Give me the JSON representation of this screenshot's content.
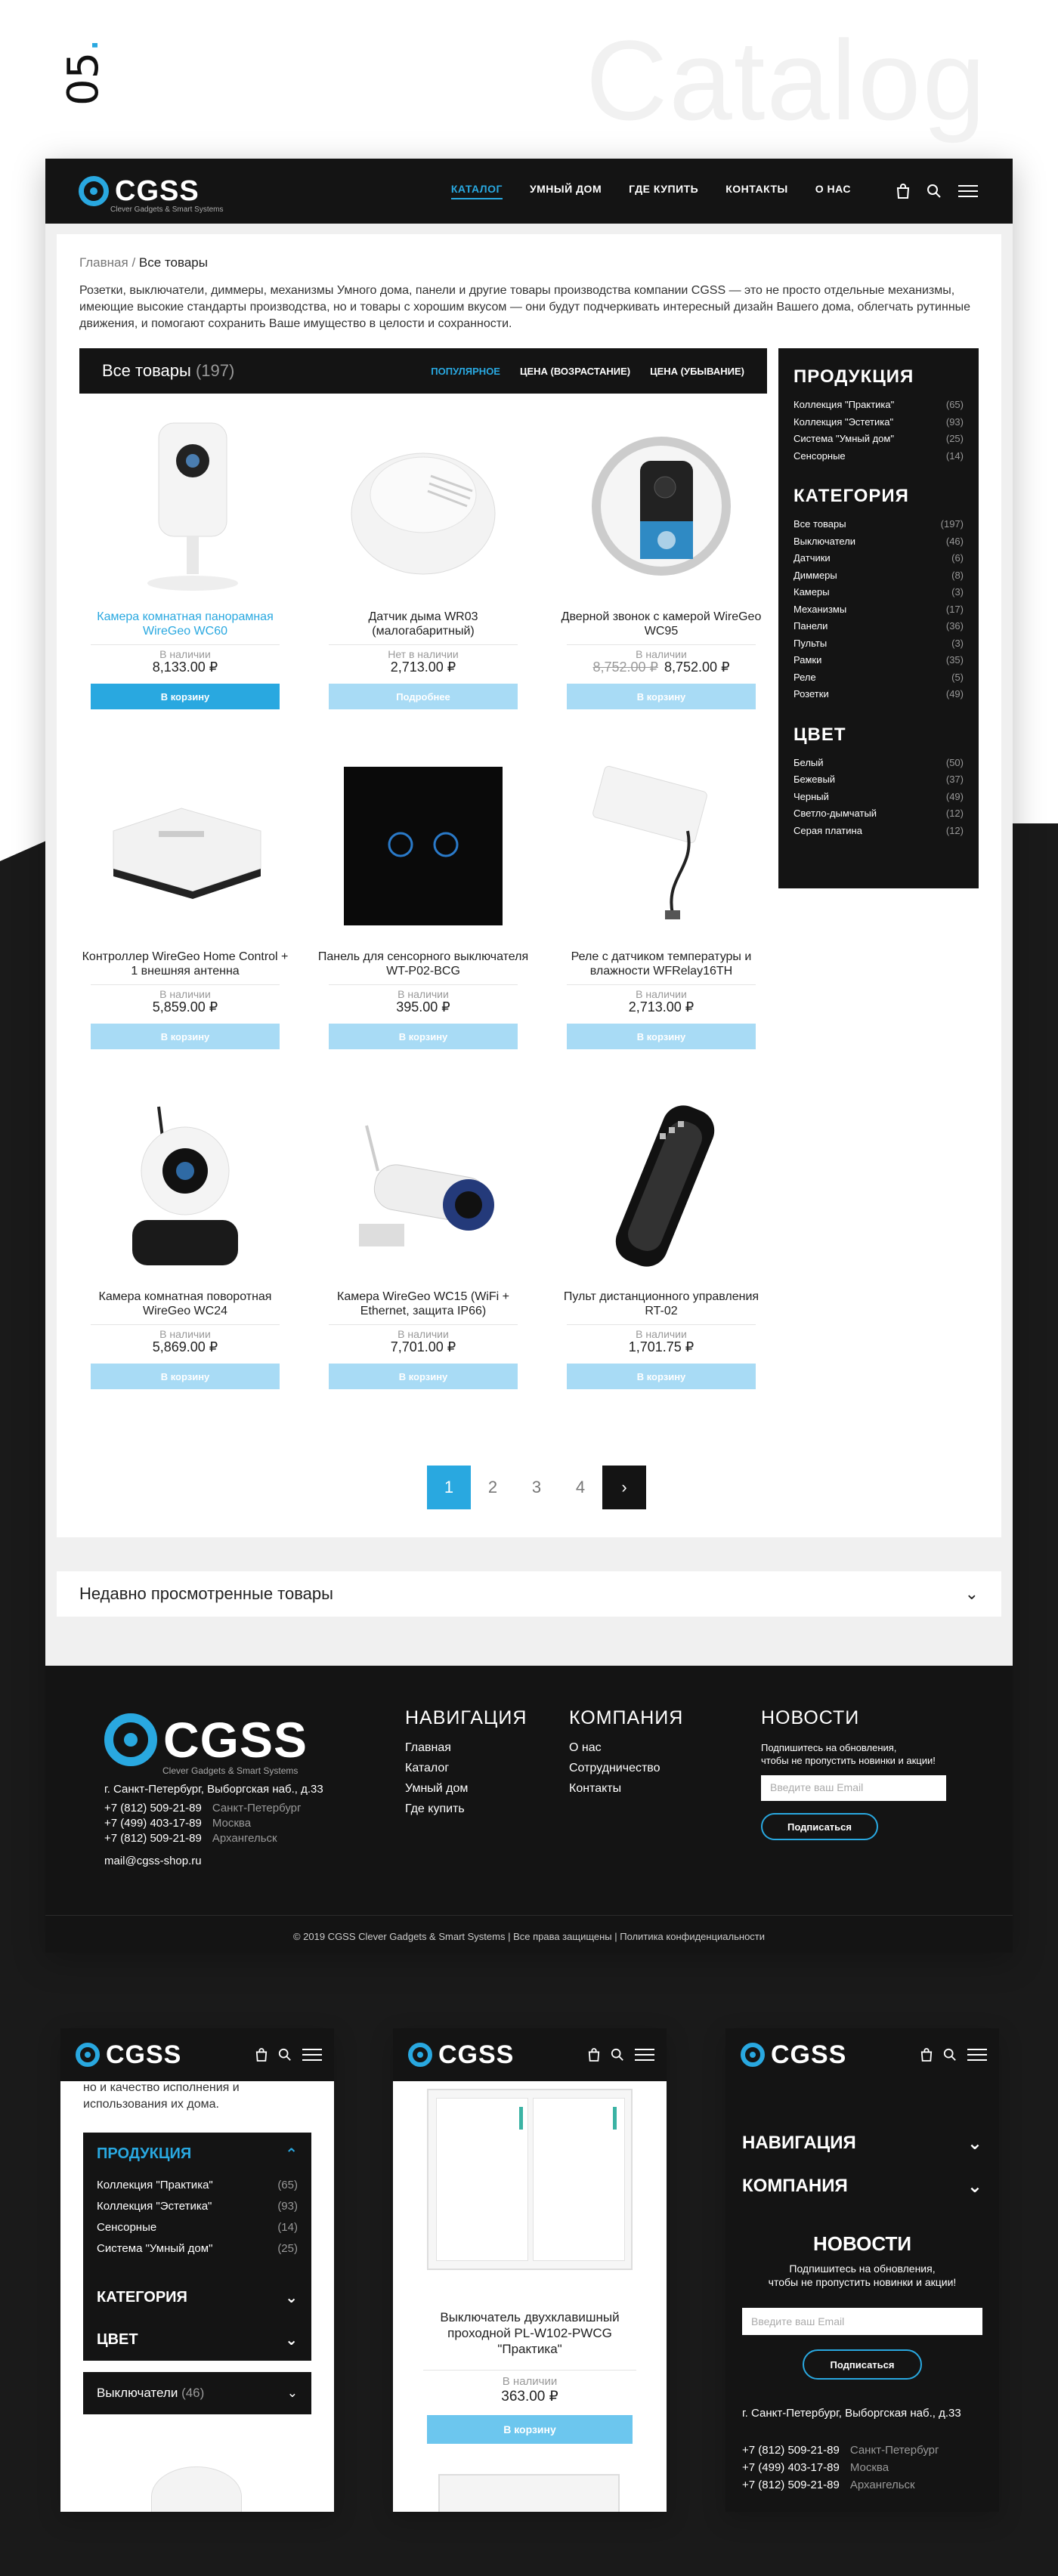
{
  "section_number": "05",
  "section_title": "Catalog",
  "header": {
    "logo": "CGSS",
    "tagline": "Clever Gadgets & Smart Systems",
    "nav": [
      "КАТАЛОГ",
      "УМНЫЙ ДОМ",
      "ГДЕ КУПИТЬ",
      "КОНТАКТЫ",
      "О НАС"
    ]
  },
  "breadcrumb": {
    "home": "Главная",
    "sep": "/",
    "current": "Все товары"
  },
  "intro": "Розетки, выключатели, диммеры, механизмы Умного дома, панели и другие товары производства компании CGSS — это не просто отдельные механизмы, имеющие высокие стандарты производства, но и товары с хорошим вкусом — они будут подчеркивать интересный дизайн Вашего дома, облегчать рутинные движения, и помогают сохранить Ваше имущество в целости и сохранности.",
  "sortbar": {
    "title": "Все товары",
    "count": "(197)",
    "sorts": [
      "ПОПУЛЯРНОЕ",
      "ЦЕНА (ВОЗРАСТАНИЕ)",
      "ЦЕНА (УБЫВАНИЕ)"
    ]
  },
  "products": [
    {
      "name": "Камера комнатная панорамная WireGeo WC60",
      "stock": "В наличии",
      "old_price": "",
      "price": "8,133.00 ₽",
      "button": "В корзину",
      "icon": "camera-icon"
    },
    {
      "name": "Датчик дыма WR03 (малогабаритный)",
      "stock": "Нет в наличии",
      "old_price": "",
      "price": "2,713.00 ₽",
      "button": "Подробнее",
      "icon": "smoke-detector-icon"
    },
    {
      "name": "Дверной звонок с камерой WireGeo WC95",
      "stock": "В наличии",
      "old_price": "8,752.00 ₽",
      "price": "8,752.00 ₽",
      "button": "В корзину",
      "icon": "doorbell-icon"
    },
    {
      "name": "Контроллер WireGeo Home Control + 1 внешняя антенна",
      "stock": "В наличии",
      "old_price": "",
      "price": "5,859.00 ₽",
      "button": "В корзину",
      "icon": "controller-icon"
    },
    {
      "name": "Панель для сенсорного выключателя WT-P02-BCG",
      "stock": "В наличии",
      "old_price": "",
      "price": "395.00 ₽",
      "button": "В корзину",
      "icon": "touch-panel-icon"
    },
    {
      "name": "Реле с датчиком температуры и влажности WFRelay16TH",
      "stock": "В наличии",
      "old_price": "",
      "price": "2,713.00 ₽",
      "button": "В корзину",
      "icon": "relay-icon"
    },
    {
      "name": "Камера комнатная поворотная WireGeo WC24",
      "stock": "В наличии",
      "old_price": "",
      "price": "5,869.00 ₽",
      "button": "В корзину",
      "icon": "ptz-camera-icon"
    },
    {
      "name": "Камера WireGeo WC15 (WiFi + Ethernet, защита IP66)",
      "stock": "В наличии",
      "old_price": "",
      "price": "7,701.00 ₽",
      "button": "В корзину",
      "icon": "outdoor-camera-icon"
    },
    {
      "name": "Пульт дистанционного управления RT-02",
      "stock": "В наличии",
      "old_price": "",
      "price": "1,701.75 ₽",
      "button": "В корзину",
      "icon": "remote-icon"
    }
  ],
  "sidebar": {
    "groups": [
      {
        "title": "ПРОДУКЦИЯ",
        "items": [
          {
            "label": "Коллекция \"Практика\"",
            "count": "(65)"
          },
          {
            "label": "Коллекция \"Эстетика\"",
            "count": "(93)"
          },
          {
            "label": "Система \"Умный дом\"",
            "count": "(25)"
          },
          {
            "label": "Сенсорные",
            "count": "(14)"
          }
        ]
      },
      {
        "title": "КАТЕГОРИЯ",
        "items": [
          {
            "label": "Все товары",
            "count": "(197)"
          },
          {
            "label": "Выключатели",
            "count": "(46)"
          },
          {
            "label": "Датчики",
            "count": "(6)"
          },
          {
            "label": "Диммеры",
            "count": "(8)"
          },
          {
            "label": "Камеры",
            "count": "(3)"
          },
          {
            "label": "Механизмы",
            "count": "(17)"
          },
          {
            "label": "Панели",
            "count": "(36)"
          },
          {
            "label": "Пульты",
            "count": "(3)"
          },
          {
            "label": "Рамки",
            "count": "(35)"
          },
          {
            "label": "Реле",
            "count": "(5)"
          },
          {
            "label": "Розетки",
            "count": "(49)"
          }
        ]
      },
      {
        "title": "ЦВЕТ",
        "items": [
          {
            "label": "Белый",
            "count": "(50)"
          },
          {
            "label": "Бежевый",
            "count": "(37)"
          },
          {
            "label": "Черный",
            "count": "(49)"
          },
          {
            "label": "Светло-дымчатый",
            "count": "(12)"
          },
          {
            "label": "Серая платина",
            "count": "(12)"
          }
        ]
      }
    ]
  },
  "pagination": {
    "pages": [
      "1",
      "2",
      "3",
      "4"
    ],
    "current": "1",
    "next": "›"
  },
  "recent": {
    "title": "Недавно просмотренные товары"
  },
  "footer": {
    "address": "г. Санкт-Петербург, Выборгская наб., д.33",
    "phones": [
      {
        "num": "+7 (812) 509-21-89",
        "city": "Санкт-Петербург"
      },
      {
        "num": "+7 (499) 403-17-89",
        "city": "Москва"
      },
      {
        "num": "+7 (812) 509-21-89",
        "city": "Архангельск"
      }
    ],
    "email": "mail@cgss-shop.ru",
    "nav_title": "НАВИГАЦИЯ",
    "nav_links": [
      "Главная",
      "Каталог",
      "Умный дом",
      "Где купить"
    ],
    "company_title": "КОМПАНИЯ",
    "company_links": [
      "О нас",
      "Сотрудничество",
      "Контакты"
    ],
    "news_title": "НОВОСТИ",
    "news_text_1": "Подпишитесь на обновления,",
    "news_text_2": "чтобы не пропустить новинки и акции!",
    "email_placeholder": "Введите ваш Email",
    "subscribe": "Подписаться",
    "copyright": "© 2019 CGSS Clever Gadgets & Smart Systems | Все права защищены | Политика конфиденциальности"
  },
  "mobile1": {
    "text": "но и качество исполнения и использования их дома.",
    "panel_title": "ПРОДУКЦИЯ",
    "items": [
      {
        "label": "Коллекция \"Практика\"",
        "count": "(65)"
      },
      {
        "label": "Коллекция \"Эстетика\"",
        "count": "(93)"
      },
      {
        "label": "Сенсорные",
        "count": "(14)"
      },
      {
        "label": "Система \"Умный дом\"",
        "count": "(25)"
      }
    ],
    "category": "КАТЕГОРИЯ",
    "color": "ЦВЕТ",
    "filter": "Выключатели",
    "filter_count": "(46)"
  },
  "mobile2": {
    "name": "Выключатель двухклавишный проходной PL-W102-PWCG \"Практика\"",
    "stock": "В наличии",
    "price": "363.00 ₽",
    "button": "В корзину"
  },
  "mobile3": {
    "nav": "НАВИГАЦИЯ",
    "company": "КОМПАНИЯ",
    "news": "НОВОСТИ",
    "news_1": "Подпишитесь на обновления,",
    "news_2": "чтобы не пропустить новинки и акции!",
    "placeholder": "Введите ваш Email",
    "subscribe": "Подписаться",
    "address": "г. Санкт-Петербург, Выборгская наб., д.33"
  },
  "colors": {
    "accent": "#29a8e0",
    "dark": "#141414"
  }
}
